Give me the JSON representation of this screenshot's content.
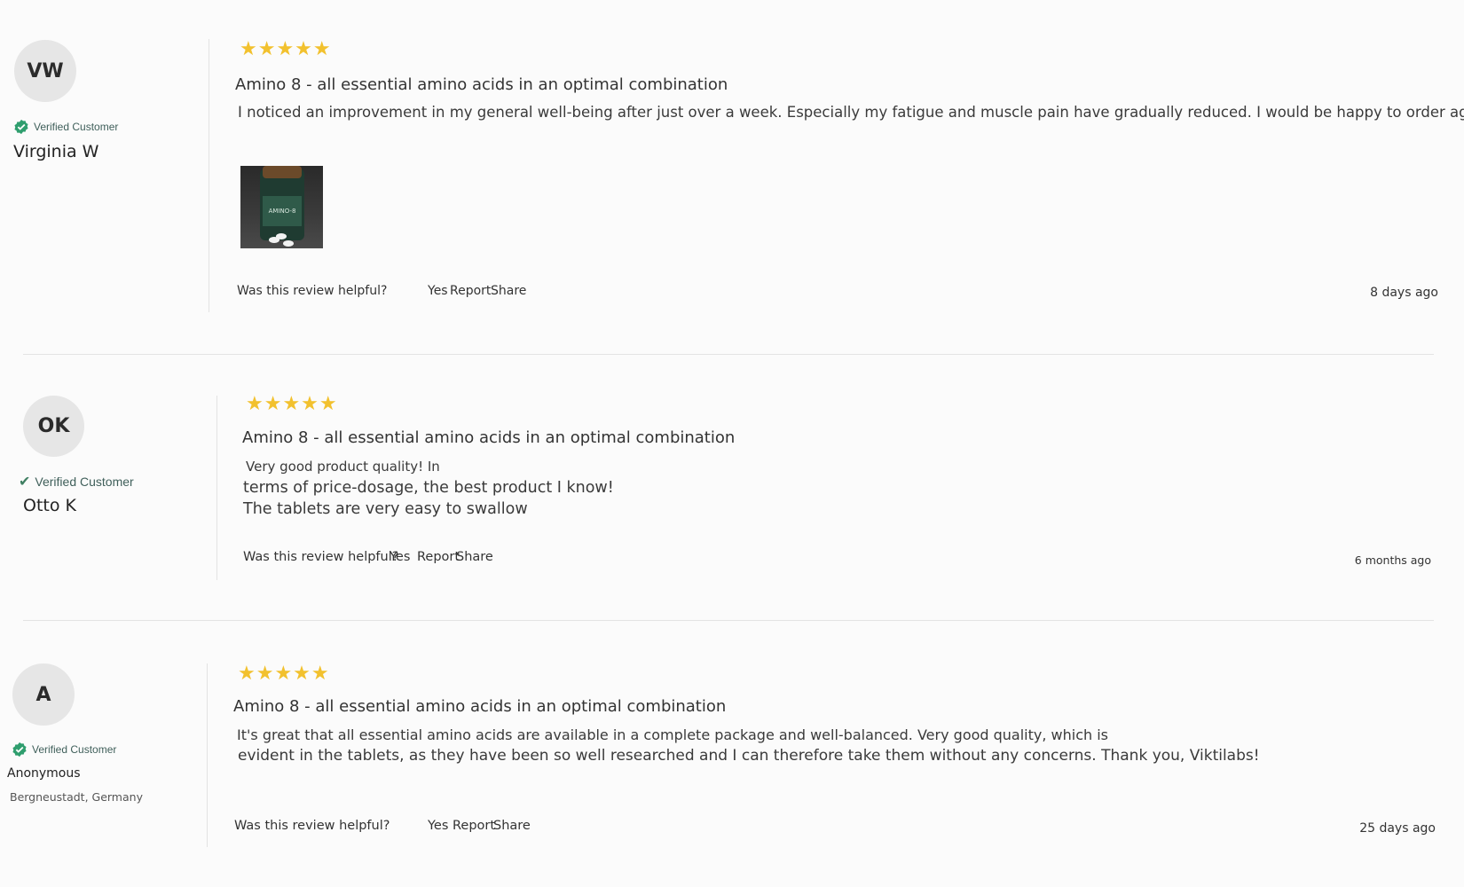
{
  "common": {
    "rating_stars": "★★★★★",
    "helpful_prompt": "Was this review helpful?",
    "yes": "Yes",
    "report": "Report",
    "share": "Share",
    "verified_label": "Verified Customer"
  },
  "reviews": [
    {
      "initials": "VW",
      "name": "Virginia W",
      "rating": 5,
      "title": "Amino 8 - all essential amino acids in an optimal combination",
      "body": [
        "I noticed an improvement in my general well-being after just over a week. Especially my fatigue and muscle pain have gradually reduced. I would be happy to order again."
      ],
      "image_alt": "Amino 8 bottle with tablets",
      "date": "8 days ago"
    },
    {
      "initials": "OK",
      "name": "Otto K",
      "rating": 5,
      "title": "Amino 8 - all essential amino acids in an optimal combination",
      "body": [
        "Very good product quality! In",
        "terms of price-dosage, the best product I know!",
        "The tablets are very easy to swallow"
      ],
      "date": "6 months ago"
    },
    {
      "initials": "A",
      "name": "Anonymous",
      "location": "Bergneustadt, Germany",
      "rating": 5,
      "title": "Amino 8 - all essential amino acids in an optimal combination",
      "body": [
        "It's great that all essential amino acids are available in a complete package and well-balanced. Very good quality, which is",
        "evident in the tablets, as they have been so well researched and I can therefore take them without any concerns. Thank you, Viktilabs!"
      ],
      "date": "25 days ago"
    }
  ],
  "colors": {
    "star": "#f2c12e",
    "verified": "#2f9e6e",
    "avatar_bg": "#e6e6e6"
  },
  "icons": {
    "verified_badge": "verified-badge-icon",
    "checkmark": "checkmark-icon"
  }
}
